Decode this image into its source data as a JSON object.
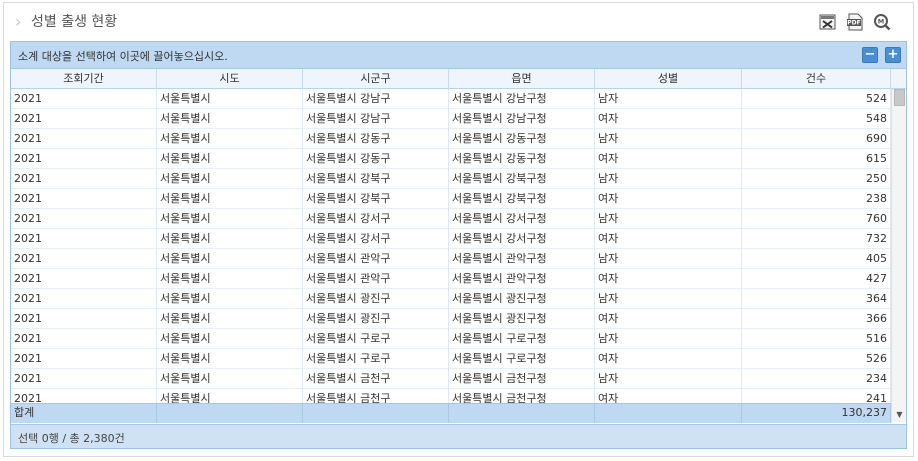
{
  "window": {
    "title": "성별 출생 현황"
  },
  "toolbar": {
    "excel_icon": "excel-export-icon",
    "pdf_icon": "pdf-export-icon",
    "zoom_icon": "magnifier-icon"
  },
  "groupbar": {
    "placeholder": "소계 대상을 선택하여 이곳에 끌어놓으십시오.",
    "minus_label": "−",
    "plus_label": "+"
  },
  "grid": {
    "columns": [
      "조회기간",
      "시도",
      "시군구",
      "읍면",
      "성별",
      "건수"
    ],
    "rows": [
      [
        "2021",
        "서울특별시",
        "서울특별시 강남구",
        "서울특별시 강남구청",
        "남자",
        "524"
      ],
      [
        "2021",
        "서울특별시",
        "서울특별시 강남구",
        "서울특별시 강남구청",
        "여자",
        "548"
      ],
      [
        "2021",
        "서울특별시",
        "서울특별시 강동구",
        "서울특별시 강동구청",
        "남자",
        "690"
      ],
      [
        "2021",
        "서울특별시",
        "서울특별시 강동구",
        "서울특별시 강동구청",
        "여자",
        "615"
      ],
      [
        "2021",
        "서울특별시",
        "서울특별시 강북구",
        "서울특별시 강북구청",
        "남자",
        "250"
      ],
      [
        "2021",
        "서울특별시",
        "서울특별시 강북구",
        "서울특별시 강북구청",
        "여자",
        "238"
      ],
      [
        "2021",
        "서울특별시",
        "서울특별시 강서구",
        "서울특별시 강서구청",
        "남자",
        "760"
      ],
      [
        "2021",
        "서울특별시",
        "서울특별시 강서구",
        "서울특별시 강서구청",
        "여자",
        "732"
      ],
      [
        "2021",
        "서울특별시",
        "서울특별시 관악구",
        "서울특별시 관악구청",
        "남자",
        "405"
      ],
      [
        "2021",
        "서울특별시",
        "서울특별시 관악구",
        "서울특별시 관악구청",
        "여자",
        "427"
      ],
      [
        "2021",
        "서울특별시",
        "서울특별시 광진구",
        "서울특별시 광진구청",
        "남자",
        "364"
      ],
      [
        "2021",
        "서울특별시",
        "서울특별시 광진구",
        "서울특별시 광진구청",
        "여자",
        "366"
      ],
      [
        "2021",
        "서울특별시",
        "서울특별시 구로구",
        "서울특별시 구로구청",
        "남자",
        "516"
      ],
      [
        "2021",
        "서울특별시",
        "서울특별시 구로구",
        "서울특별시 구로구청",
        "여자",
        "526"
      ],
      [
        "2021",
        "서울특별시",
        "서울특별시 금천구",
        "서울특별시 금천구청",
        "남자",
        "234"
      ],
      [
        "2021",
        "서울특별시",
        "서울특별시 금천구",
        "서울특별시 금천구청",
        "여자",
        "241"
      ]
    ],
    "summary": {
      "label": "합계",
      "total": "130,237"
    }
  },
  "status": {
    "text": "선택 0행 / 총 2,380건"
  },
  "colors": {
    "accent": "#4a8fd3",
    "header_bg": "#eef5fc",
    "group_bg": "#bed9f1",
    "status_bg": "#cfe2f3"
  }
}
